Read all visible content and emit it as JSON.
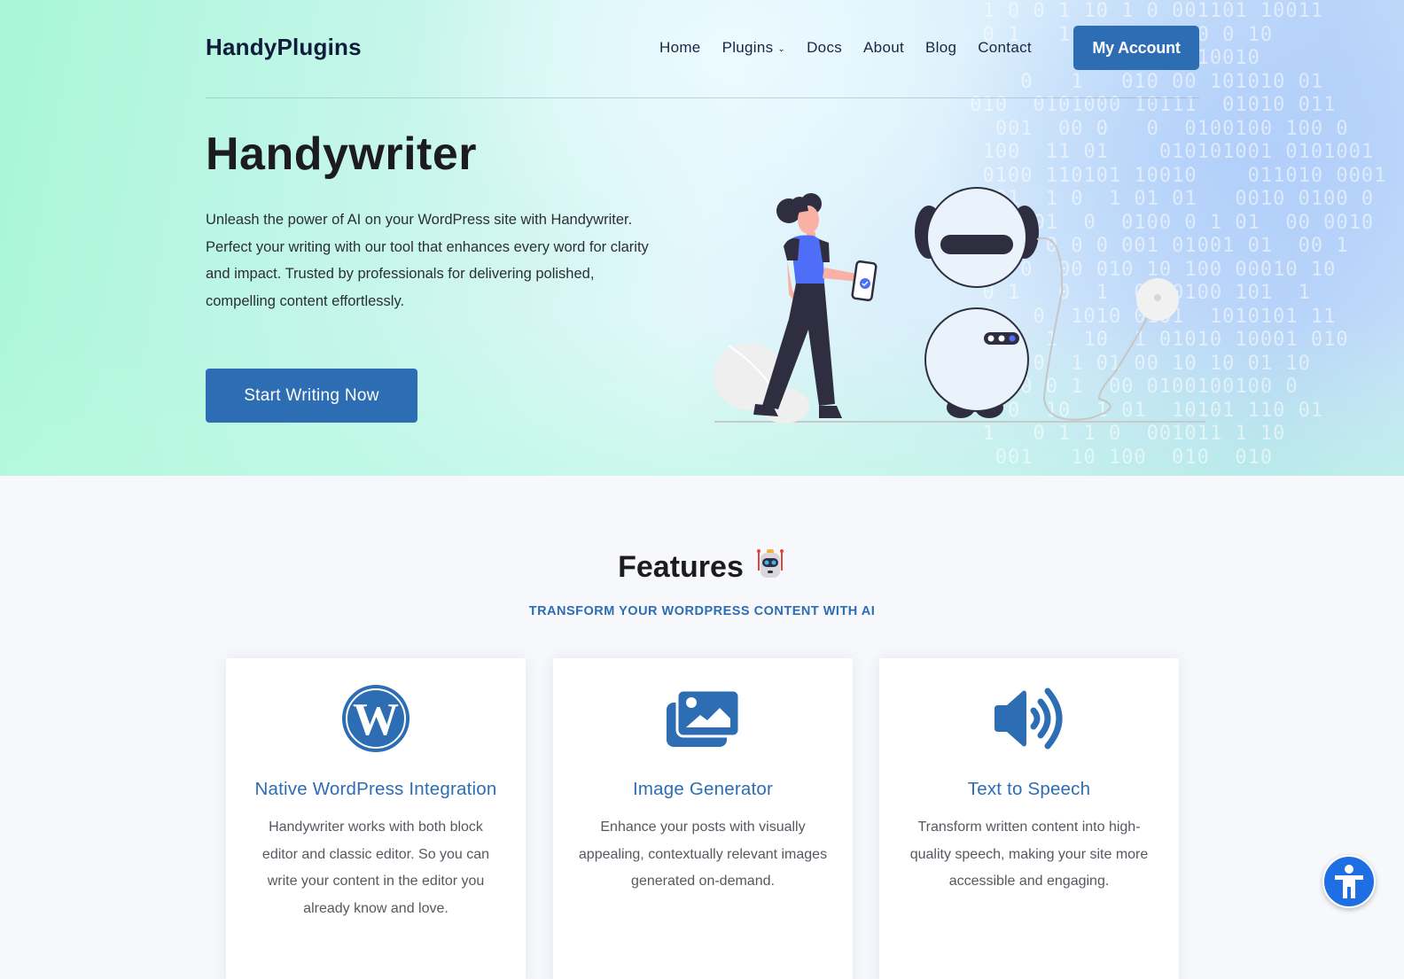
{
  "header": {
    "logo": "HandyPlugins",
    "nav": [
      {
        "label": "Home",
        "has_dropdown": false
      },
      {
        "label": "Plugins",
        "has_dropdown": true
      },
      {
        "label": "Docs",
        "has_dropdown": false
      },
      {
        "label": "About",
        "has_dropdown": false
      },
      {
        "label": "Blog",
        "has_dropdown": false
      },
      {
        "label": "Contact",
        "has_dropdown": false
      }
    ],
    "account_button": "My Account"
  },
  "hero": {
    "title": "Handywriter",
    "description": "Unleash the power of AI on your WordPress site with Handywriter. Perfect your writing with our tool that enhances every word for clarity and impact. Trusted by professionals for delivering polished, compelling content effortlessly.",
    "cta_label": "Start Writing Now",
    "illustration": "woman-with-phone-and-robot-illustration",
    "binary_rows": [
      "  1 0 0 1 10 1 0 001101 10011",
      "  0 1   1  001001000 0 10",
      "          0 10  0 010010",
      "     0   1   010 00 101010 01",
      " 010  0101000 10111  01010 011",
      "   001  00 0   0  0100100 100 0",
      "  100  11 01    010101001 0101001",
      "  0100 110101 10010    011010 0001",
      "  001  1 0  1 01 01   0010 0100 0",
      "    0 01  0  0100 0 1 01  00 0010",
      "   01  0 0 0 001 01001 01  00 1",
      " 1 1 0  00 010 10 100 00010 10",
      "  0 1   0  1  0 10100 101  1",
      "  0   0  1010 0101  1010101 11",
      "  0 0  1  10  1 01010 10001 010",
      "  0   0  1 01 00 10 10 01 10",
      "    10 0 1  00 0100100100 0",
      "  1 0  10  1 01  10101 110 01",
      "  1   0 1 1 0  001011 1 10",
      "   001   10 100  010  010"
    ],
    "colors": {
      "accent": "#2d6db3",
      "gradient_left": "#a8f6d8",
      "gradient_right": "#bcd6f8"
    }
  },
  "features": {
    "title": "Features",
    "emoji": "🤖",
    "subtitle": "TRANSFORM YOUR WORDPRESS CONTENT WITH AI",
    "cards": [
      {
        "icon": "wordpress-icon",
        "title": "Native WordPress Integration",
        "description": "Handywriter works with both block editor and classic editor. So you can write your content in the editor you already know and love."
      },
      {
        "icon": "images-icon",
        "title": "Image Generator",
        "description": "Enhance your posts with visually appealing, contextually relevant images generated on-demand."
      },
      {
        "icon": "volume-high-icon",
        "title": "Text to Speech",
        "description": "Transform written content into high-quality speech, making your site more accessible and engaging."
      }
    ]
  },
  "accessibility": {
    "label": "accessibility-widget",
    "color": "#1d6fe3"
  }
}
